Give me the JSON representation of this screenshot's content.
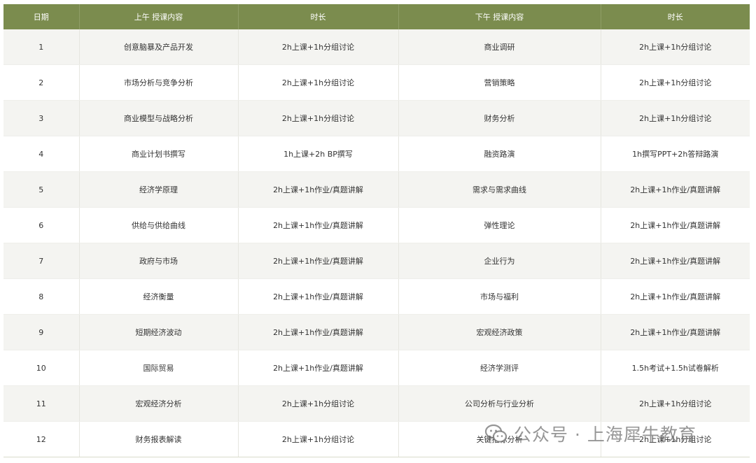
{
  "header": {
    "date": "日期",
    "am_content": "上午 授课内容",
    "am_duration": "时长",
    "pm_content": "下午 授课内容",
    "pm_duration": "时长"
  },
  "rows": [
    {
      "day": "1",
      "am": "创意脑暴及产品开发",
      "am_time": "2h上课+1h分组讨论",
      "pm": "商业调研",
      "pm_time": "2h上课+1h分组讨论"
    },
    {
      "day": "2",
      "am": "市场分析与竞争分析",
      "am_time": "2h上课+1h分组讨论",
      "pm": "营销策略",
      "pm_time": "2h上课+1h分组讨论"
    },
    {
      "day": "3",
      "am": "商业模型与战略分析",
      "am_time": "2h上课+1h分组讨论",
      "pm": "财务分析",
      "pm_time": "2h上课+1h分组讨论"
    },
    {
      "day": "4",
      "am": "商业计划书撰写",
      "am_time": "1h上课+2h BP撰写",
      "pm": "融资路演",
      "pm_time": "1h撰写PPT+2h答辩路演"
    },
    {
      "day": "5",
      "am": "经济学原理",
      "am_time": "2h上课+1h作业/真题讲解",
      "pm": "需求与需求曲线",
      "pm_time": "2h上课+1h作业/真题讲解"
    },
    {
      "day": "6",
      "am": "供给与供给曲线",
      "am_time": "2h上课+1h作业/真题讲解",
      "pm": "弹性理论",
      "pm_time": "2h上课+1h作业/真题讲解"
    },
    {
      "day": "7",
      "am": "政府与市场",
      "am_time": "2h上课+1h作业/真题讲解",
      "pm": "企业行为",
      "pm_time": "2h上课+1h作业/真题讲解"
    },
    {
      "day": "8",
      "am": "经济衡量",
      "am_time": "2h上课+1h作业/真题讲解",
      "pm": "市场与福利",
      "pm_time": "2h上课+1h作业/真题讲解"
    },
    {
      "day": "9",
      "am": "短期经济波动",
      "am_time": "2h上课+1h作业/真题讲解",
      "pm": "宏观经济政策",
      "pm_time": "2h上课+1h作业/真题讲解"
    },
    {
      "day": "10",
      "am": "国际贸易",
      "am_time": "2h上课+1h作业/真题讲解",
      "pm": "经济学测评",
      "pm_time": "1.5h考试+1.5h试卷解析"
    },
    {
      "day": "11",
      "am": "宏观经济分析",
      "am_time": "2h上课+1h分组讨论",
      "pm": "公司分析与行业分析",
      "pm_time": "2h上课+1h分组讨论"
    },
    {
      "day": "12",
      "am": "财务报表解读",
      "am_time": "2h上课+1h分组讨论",
      "pm": "关键指标分析",
      "pm_time": "2h上课+1h分组讨论"
    }
  ],
  "watermark": {
    "icon": "wechat-icon",
    "text": "公众号 · 上海犀牛教育"
  },
  "colors": {
    "header_bg": "#7b8c4e",
    "header_text": "#ffffff",
    "row_alt_bg": "#f4f4f1",
    "row_bg": "#ffffff",
    "text": "#333333"
  }
}
